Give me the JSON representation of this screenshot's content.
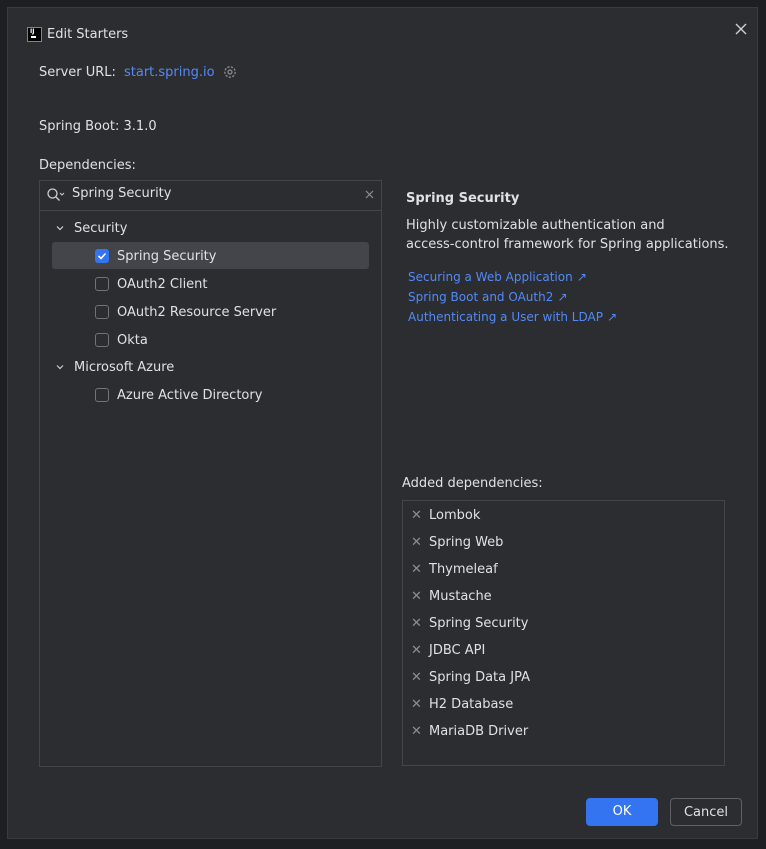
{
  "dialog": {
    "title": "Edit Starters",
    "server_url_label": "Server URL:",
    "server_url_value": "start.spring.io",
    "spring_boot_label": "Spring Boot:",
    "spring_boot_version": "3.1.0",
    "dependencies_label": "Dependencies:",
    "search_value": "Spring Security",
    "tree": {
      "groups": [
        {
          "label": "Security",
          "items": [
            {
              "label": "Spring Security",
              "checked": true,
              "selected": true
            },
            {
              "label": "OAuth2 Client",
              "checked": false
            },
            {
              "label": "OAuth2 Resource Server",
              "checked": false
            },
            {
              "label": "Okta",
              "checked": false
            }
          ]
        },
        {
          "label": "Microsoft Azure",
          "items": [
            {
              "label": "Azure Active Directory",
              "checked": false
            }
          ]
        }
      ]
    },
    "detail": {
      "title": "Spring Security",
      "description_line1": "Highly customizable authentication and",
      "description_line2": "access-control framework for Spring applications.",
      "links": [
        "Securing a Web Application",
        "Spring Boot and OAuth2",
        "Authenticating a User with LDAP"
      ]
    },
    "added_label": "Added dependencies:",
    "added": [
      "Lombok",
      "Spring Web",
      "Thymeleaf",
      "Mustache",
      "Spring Security",
      "JDBC API",
      "Spring Data JPA",
      "H2 Database",
      "MariaDB Driver"
    ],
    "ok_label": "OK",
    "cancel_label": "Cancel"
  },
  "colors": {
    "accent": "#3574f0",
    "link": "#548af7",
    "background": "#2b2d30"
  }
}
